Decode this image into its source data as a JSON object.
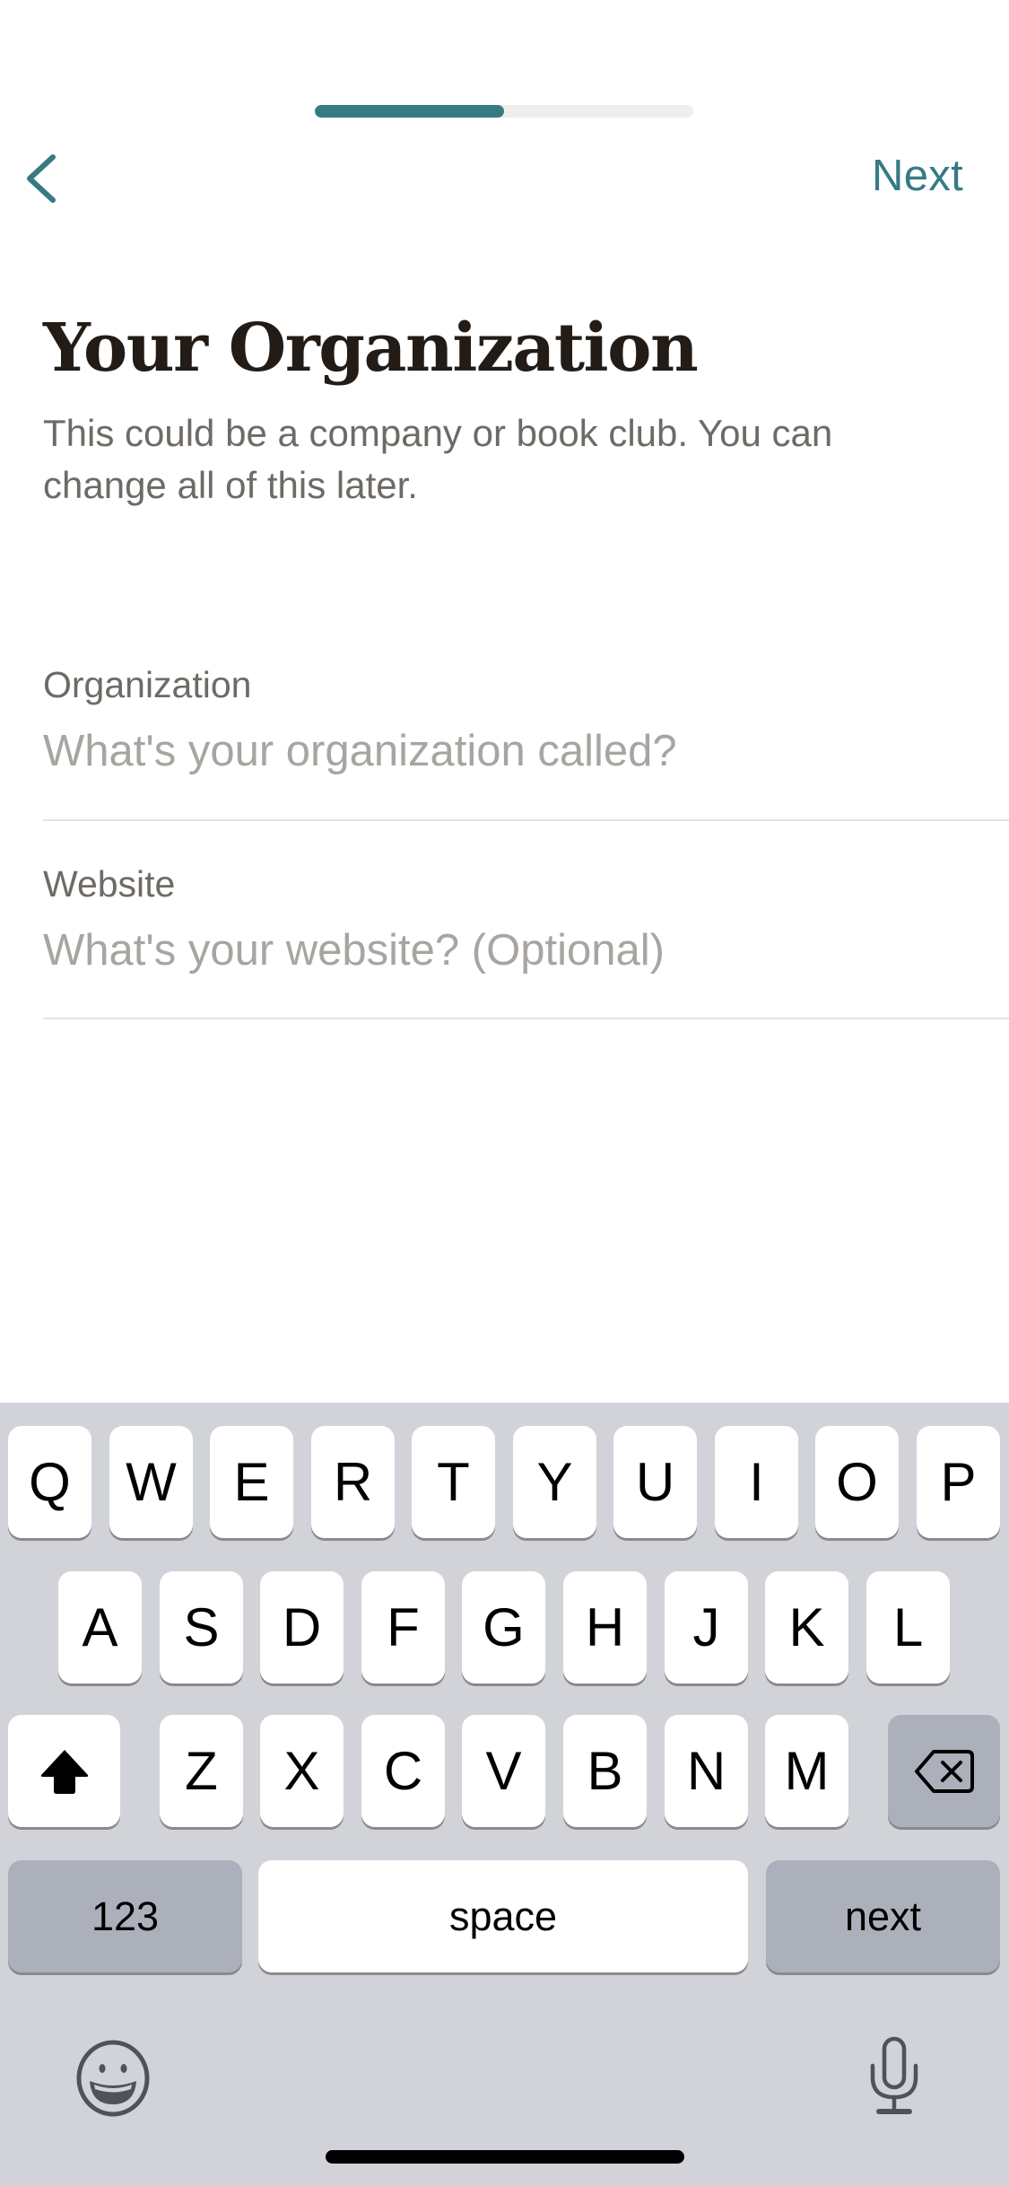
{
  "nav": {
    "back_icon": "chevron-left-icon",
    "next_label": "Next",
    "progress_percent": 50
  },
  "colors": {
    "accent": "#367a84",
    "title": "#231c16",
    "body_text": "#6e6a65",
    "placeholder": "#a8a5a1",
    "progress_track": "#efeeeb"
  },
  "page": {
    "title": "Your Organization",
    "subtitle": "This could be a company or book club. You can change all of this later."
  },
  "form": {
    "fields": [
      {
        "label": "Organization",
        "value": "",
        "placeholder": "What's your organization called?"
      },
      {
        "label": "Website",
        "value": "",
        "placeholder": "What's your website? (Optional)"
      }
    ]
  },
  "keyboard": {
    "row1": [
      "Q",
      "W",
      "E",
      "R",
      "T",
      "Y",
      "U",
      "I",
      "O",
      "P"
    ],
    "row2": [
      "A",
      "S",
      "D",
      "F",
      "G",
      "H",
      "J",
      "K",
      "L"
    ],
    "row3": [
      "Z",
      "X",
      "C",
      "V",
      "B",
      "N",
      "M"
    ],
    "shift_icon": "shift-icon",
    "delete_icon": "delete-icon",
    "numbers_label": "123",
    "space_label": "space",
    "return_label": "next",
    "emoji_icon": "emoji-icon",
    "mic_icon": "microphone-icon"
  }
}
